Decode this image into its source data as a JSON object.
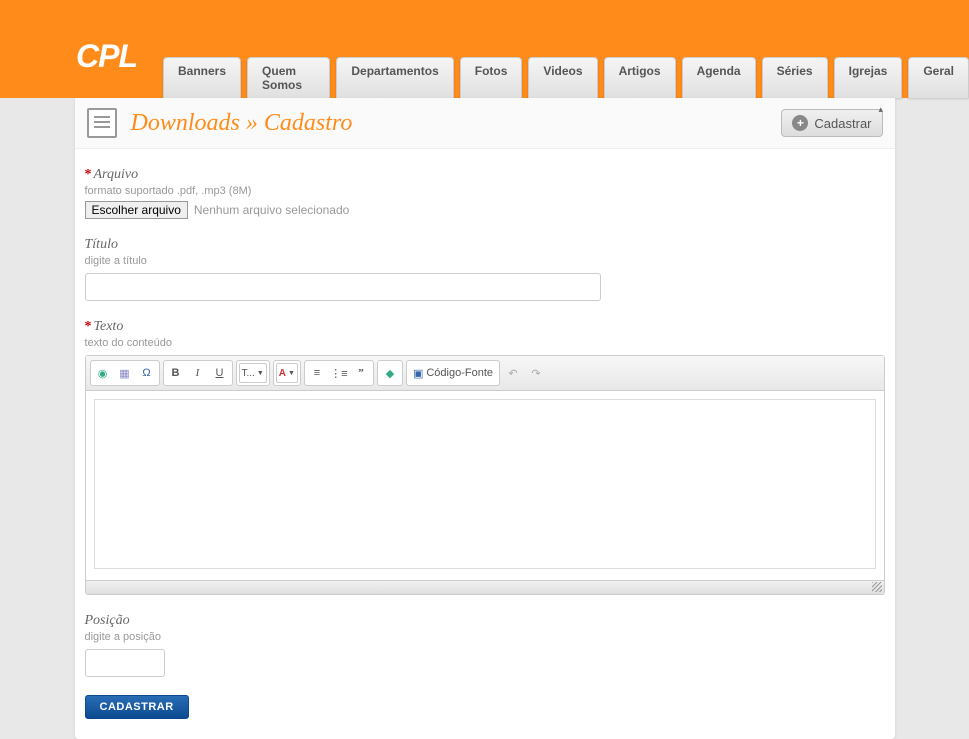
{
  "logo_text": "CPL",
  "nav": [
    "Banners",
    "Quem Somos",
    "Departamentos",
    "Fotos",
    "Videos",
    "Artigos",
    "Agenda",
    "Séries",
    "Igrejas",
    "Geral"
  ],
  "page_title": "Downloads » Cadastro",
  "header_button": "Cadastrar",
  "fields": {
    "arquivo": {
      "label": "Arquivo",
      "hint": "formato suportado .pdf, .mp3 (8M)",
      "choose_button": "Escolher arquivo",
      "no_file_text": "Nenhum arquivo selecionado"
    },
    "titulo": {
      "label": "Título",
      "hint": "digite a título",
      "value": ""
    },
    "texto": {
      "label": "Texto",
      "hint": "texto do conteúdo",
      "value": ""
    },
    "posicao": {
      "label": "Posição",
      "hint": "digite a posição",
      "value": ""
    }
  },
  "editor": {
    "font_size_label": "T...",
    "color_label": "A",
    "source_label": "Código-Fonte"
  },
  "submit_label": "CADASTRAR"
}
